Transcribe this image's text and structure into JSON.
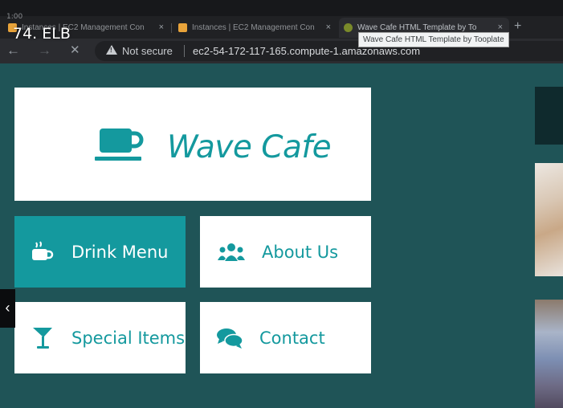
{
  "overlay": {
    "video_title": "74. ELB",
    "top_time": "1:00"
  },
  "browser": {
    "tabs": [
      {
        "title": "Instances | EC2 Management Con",
        "favicon_color": "#e8a33a",
        "active": false
      },
      {
        "title": "Instances | EC2 Management Con",
        "favicon_color": "#e8a33a",
        "active": false
      },
      {
        "title": "Wave Cafe HTML Template by To",
        "favicon_color": "#7a8a2a",
        "active": true
      }
    ],
    "tab_close_glyph": "×",
    "new_tab_glyph": "+",
    "tooltip": "Wave Cafe HTML Template by Tooplate",
    "nav": {
      "back_glyph": "←",
      "forward_glyph": "→",
      "stop_glyph": "✕"
    },
    "security_label": "Not secure",
    "url": "ec2-54-172-117-165.compute-1.amazonaws.com"
  },
  "site": {
    "brand": "Wave Cafe",
    "accent_color": "#14999e",
    "background_color": "#1f5457",
    "nav": [
      {
        "label": "Drink Menu",
        "icon": "coffee-cup-icon",
        "active": true
      },
      {
        "label": "About Us",
        "icon": "users-icon",
        "active": false
      },
      {
        "label": "Special Items",
        "icon": "cocktail-glass-icon",
        "active": false
      },
      {
        "label": "Contact",
        "icon": "comments-icon",
        "active": false
      }
    ]
  },
  "carousel": {
    "prev_glyph": "‹"
  }
}
